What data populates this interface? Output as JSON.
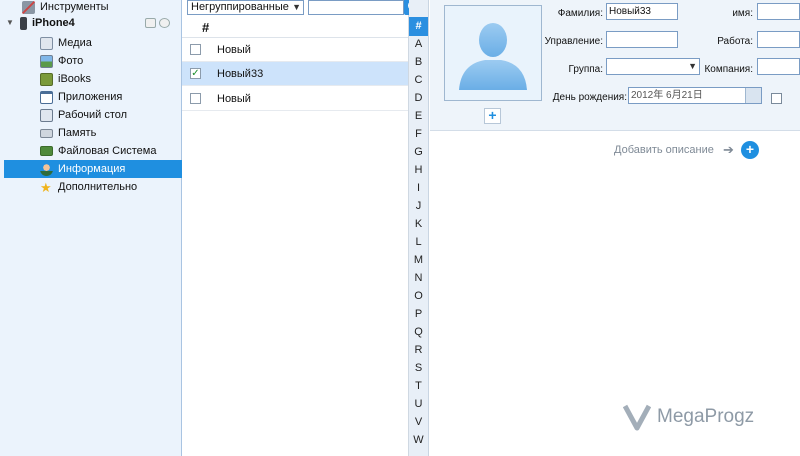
{
  "sidebar": {
    "tools_label": "Инструменты",
    "device_label": "iPhone4",
    "items": [
      {
        "label": "Медиа",
        "icon": "media-icon"
      },
      {
        "label": "Фото",
        "icon": "photo-icon"
      },
      {
        "label": "iBooks",
        "icon": "ibooks-icon"
      },
      {
        "label": "Приложения",
        "icon": "apps-icon"
      },
      {
        "label": "Рабочий стол",
        "icon": "desktop-icon"
      },
      {
        "label": "Память",
        "icon": "memory-icon"
      },
      {
        "label": "Файловая Система",
        "icon": "folder-icon"
      },
      {
        "label": "Информация",
        "icon": "contact-icon"
      },
      {
        "label": "Дополнительно",
        "icon": "star-icon"
      }
    ],
    "selected_item": "Информация"
  },
  "contacts": {
    "group_select_value": "Негруппированные",
    "search_placeholder": "",
    "header": "#",
    "rows": [
      {
        "name": "Новый",
        "checked": false
      },
      {
        "name": "Новый33",
        "checked": true
      },
      {
        "name": "Новый",
        "checked": false
      }
    ]
  },
  "alphabet": {
    "head": "#",
    "letters": [
      "A",
      "B",
      "C",
      "D",
      "E",
      "F",
      "G",
      "H",
      "I",
      "J",
      "K",
      "L",
      "M",
      "N",
      "O",
      "P",
      "Q",
      "R",
      "S",
      "T",
      "U",
      "V",
      "W"
    ]
  },
  "detail": {
    "surname_label": "Фамилия:",
    "surname_value": "Новый33",
    "name_label": "имя:",
    "department_label": "Управление:",
    "job_label": "Работа:",
    "group_label": "Группа:",
    "company_label": "Компания:",
    "birthday_label": "День рождения:",
    "birthday_value": "2012年 6月21日",
    "add_description": "Добавить описание"
  },
  "watermark": "MegaProgz",
  "colors": {
    "accent": "#1f8fe0",
    "sidebar_bg": "#ebf3fc",
    "selected_row": "#cde3fb"
  }
}
